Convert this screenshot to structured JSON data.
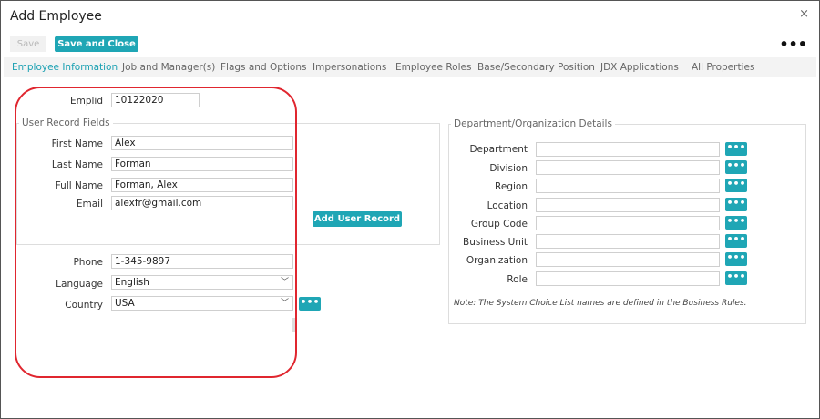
{
  "window": {
    "title": "Add Employee",
    "close_glyph": "×"
  },
  "toolbar": {
    "save_label": "Save",
    "save_close_label": "Save and Close",
    "more_glyph": "•••"
  },
  "tabs": [
    "Employee Information",
    "Job and Manager(s)",
    "Flags and Options",
    "Impersonations",
    "Employee Roles",
    "Base/Secondary Position",
    "JDX Applications",
    "All Properties"
  ],
  "emplid": {
    "label": "Emplid",
    "value": "10122020"
  },
  "user_record": {
    "legend": "User Record Fields",
    "first_name": {
      "label": "First Name",
      "value": "Alex"
    },
    "last_name": {
      "label": "Last Name",
      "value": "Forman"
    },
    "full_name": {
      "label": "Full Name",
      "value": "Forman, Alex"
    },
    "email": {
      "label": "Email",
      "value": "alexfr@gmail.com"
    },
    "add_button": "Add User Record"
  },
  "contact": {
    "phone": {
      "label": "Phone",
      "value": "1-345-9897"
    },
    "language": {
      "label": "Language",
      "value": "English"
    },
    "country": {
      "label": "Country",
      "value": "USA"
    }
  },
  "dept_org": {
    "legend": "Department/Organization Details",
    "fields": [
      "Department",
      "Division",
      "Region",
      "Location",
      "Group Code",
      "Business Unit",
      "Organization",
      "Role"
    ],
    "note": "Note: The System Choice List names are defined in the Business Rules."
  },
  "glyphs": {
    "dots_button": "•••",
    "chevron": "﹀"
  },
  "colors": {
    "accent": "#1fa6b5",
    "highlight": "#e0262f"
  }
}
